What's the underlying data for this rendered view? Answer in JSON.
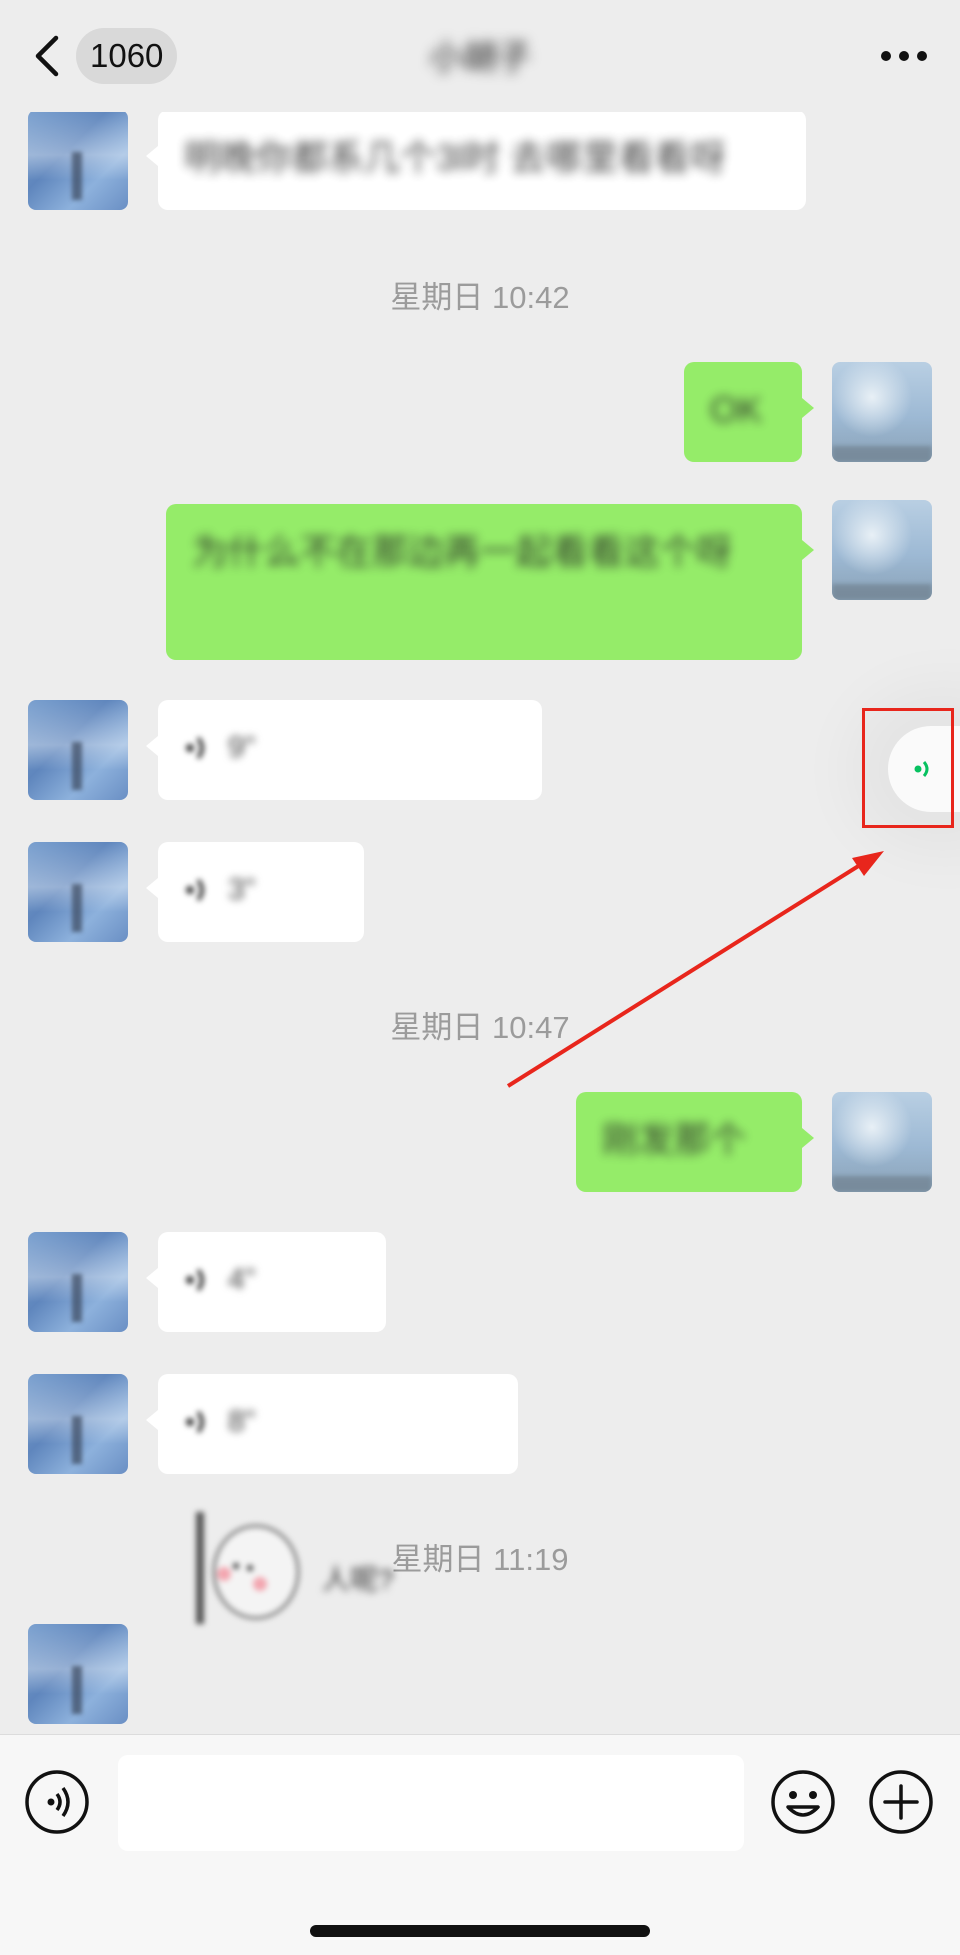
{
  "header": {
    "back_badge": "1060",
    "title": "小胡子"
  },
  "messages": [
    {
      "type": "text",
      "from": "them",
      "text": "明晚你都系几个3l时 去哪里看看呀"
    },
    {
      "type": "time",
      "text": "星期日 10:42"
    },
    {
      "type": "text",
      "from": "me",
      "text": "OK"
    },
    {
      "type": "text",
      "from": "me",
      "text": "为什么不在那边再一起看看这个呀"
    },
    {
      "type": "voice",
      "from": "them",
      "duration": "9\""
    },
    {
      "type": "voice",
      "from": "them",
      "duration": "3\""
    },
    {
      "type": "time",
      "text": "星期日 10:47"
    },
    {
      "type": "text",
      "from": "me",
      "text": "刚发那个"
    },
    {
      "type": "voice",
      "from": "them",
      "duration": "4\""
    },
    {
      "type": "voice",
      "from": "them",
      "duration": "8\""
    },
    {
      "type": "time",
      "text": "星期日 11:19"
    },
    {
      "type": "sticker",
      "from": "them",
      "caption": "人呢?"
    }
  ],
  "input_bar": {
    "placeholder": "",
    "icons": [
      "voice-input-icon",
      "emoji-icon",
      "plus-icon"
    ]
  },
  "colors": {
    "background": "#ededed",
    "my_bubble": "#95ec69",
    "their_bubble": "#ffffff",
    "wechat_green": "#07c160",
    "annotation_red": "#e8261c"
  }
}
